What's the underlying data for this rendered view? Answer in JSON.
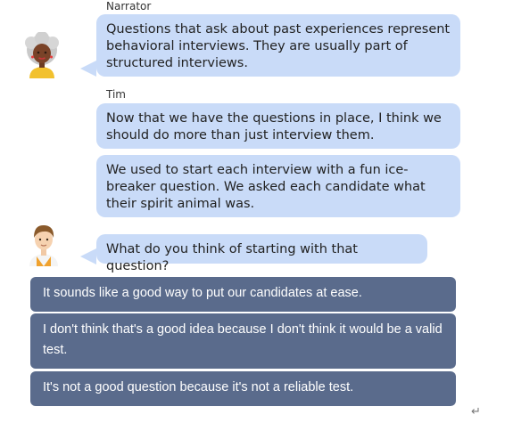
{
  "conversation": {
    "narrator": {
      "name": "Narrator",
      "avatar_icon": "narrator-avatar-icon",
      "message": "Questions that ask about past experiences represent behavioral interviews. They are usually part of structured interviews."
    },
    "tim": {
      "name": "Tim",
      "avatar_icon": "tim-avatar-icon",
      "messages": [
        "Now that we have the questions in place, I think we should do more than just interview them.",
        "We used to start each interview with a fun ice-breaker question. We asked each candidate what their spirit animal was.",
        "What do you think of starting with that question?"
      ]
    }
  },
  "choices": [
    "It sounds like a good way to put our candidates at ease.",
    "I don't think that's a good idea because I don't think it would be a valid test.",
    "It's not a good question because it's not a reliable test."
  ],
  "footer": {
    "return_icon": "↵"
  },
  "colors": {
    "bubble": "#c9dbf8",
    "choice": "#5a6b8c",
    "choice_text": "#ffffff"
  }
}
